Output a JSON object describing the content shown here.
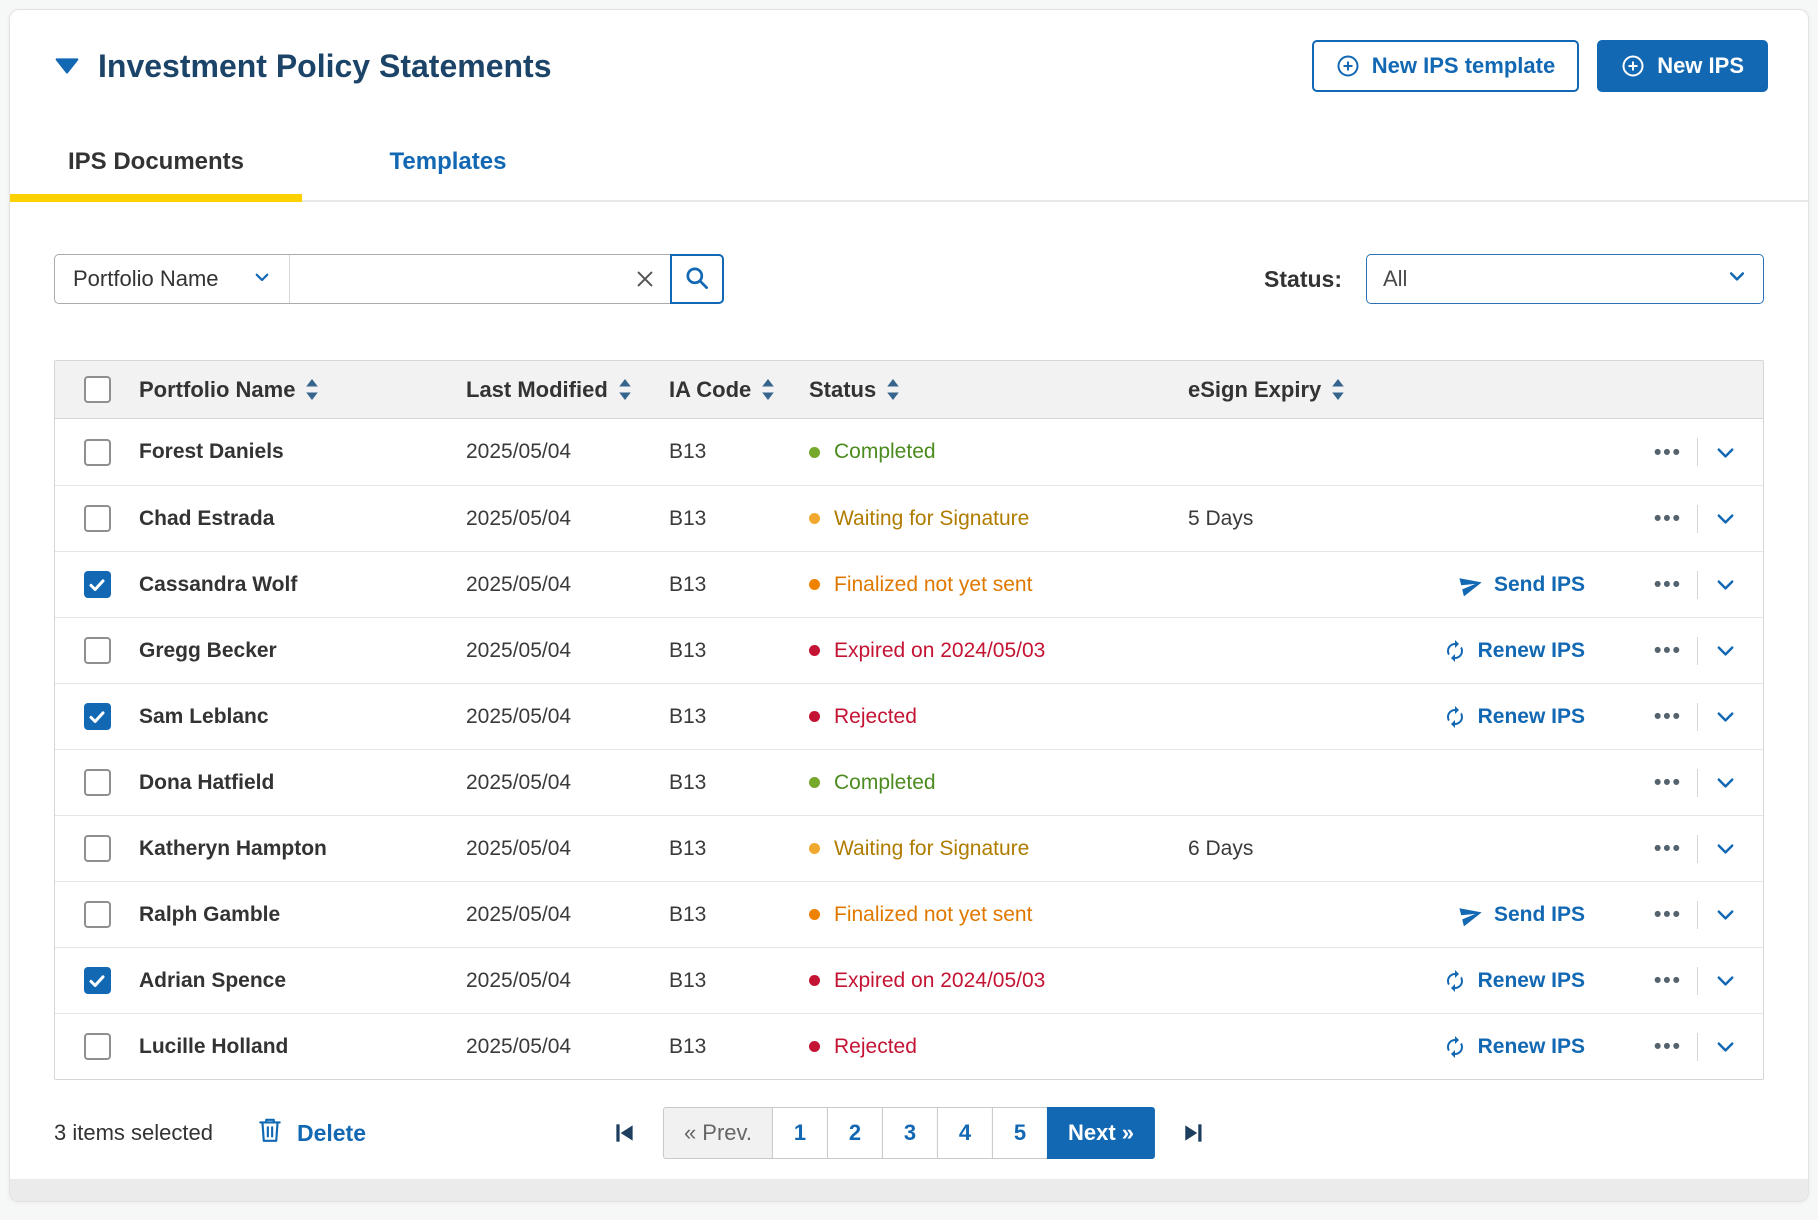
{
  "header": {
    "title": "Investment Policy Statements",
    "buttons": {
      "new_template": "New IPS template",
      "new_ips": "New IPS"
    }
  },
  "tabs": {
    "items": [
      {
        "label": "IPS Documents",
        "active": true
      },
      {
        "label": "Templates",
        "active": false
      }
    ]
  },
  "toolbar": {
    "search_field_selector": "Portfolio Name",
    "search_value": "",
    "status_label": "Status:",
    "status_value": "All"
  },
  "table": {
    "columns": [
      {
        "label": "Portfolio Name",
        "sortable": true
      },
      {
        "label": "Last Modified",
        "sortable": true
      },
      {
        "label": "IA Code",
        "sortable": true
      },
      {
        "label": "Status",
        "sortable": true
      },
      {
        "label": "eSign Expiry",
        "sortable": true
      }
    ],
    "status_colors": {
      "completed": {
        "dot": "#76a829",
        "text": "#4c8b1f"
      },
      "waiting": {
        "dot": "#f0a92e",
        "text": "#b07c00"
      },
      "finalized": {
        "dot": "#ef8200",
        "text": "#e07800"
      },
      "expired": {
        "dot": "#c41434",
        "text": "#c41434"
      },
      "rejected": {
        "dot": "#c41434",
        "text": "#c41434"
      }
    },
    "rows": [
      {
        "checked": false,
        "name": "Forest Daniels",
        "modified": "2025/05/04",
        "ia": "B13",
        "status": "Completed",
        "status_type": "completed",
        "expiry": "",
        "action": null
      },
      {
        "checked": false,
        "name": "Chad Estrada",
        "modified": "2025/05/04",
        "ia": "B13",
        "status": "Waiting for Signature",
        "status_type": "waiting",
        "expiry": "5 Days",
        "action": null
      },
      {
        "checked": true,
        "name": "Cassandra Wolf",
        "modified": "2025/05/04",
        "ia": "B13",
        "status": "Finalized not yet sent",
        "status_type": "finalized",
        "expiry": "",
        "action": {
          "type": "send",
          "label": "Send IPS"
        }
      },
      {
        "checked": false,
        "name": "Gregg Becker",
        "modified": "2025/05/04",
        "ia": "B13",
        "status": "Expired on 2024/05/03",
        "status_type": "expired",
        "expiry": "",
        "action": {
          "type": "renew",
          "label": "Renew IPS"
        }
      },
      {
        "checked": true,
        "name": "Sam Leblanc",
        "modified": "2025/05/04",
        "ia": "B13",
        "status": "Rejected",
        "status_type": "rejected",
        "expiry": "",
        "action": {
          "type": "renew",
          "label": "Renew IPS"
        }
      },
      {
        "checked": false,
        "name": "Dona Hatfield",
        "modified": "2025/05/04",
        "ia": "B13",
        "status": "Completed",
        "status_type": "completed",
        "expiry": "",
        "action": null
      },
      {
        "checked": false,
        "name": "Katheryn Hampton",
        "modified": "2025/05/04",
        "ia": "B13",
        "status": "Waiting for Signature",
        "status_type": "waiting",
        "expiry": "6 Days",
        "action": null
      },
      {
        "checked": false,
        "name": "Ralph Gamble",
        "modified": "2025/05/04",
        "ia": "B13",
        "status": "Finalized not yet sent",
        "status_type": "finalized",
        "expiry": "",
        "action": {
          "type": "send",
          "label": "Send IPS"
        }
      },
      {
        "checked": true,
        "name": "Adrian Spence",
        "modified": "2025/05/04",
        "ia": "B13",
        "status": "Expired on 2024/05/03",
        "status_type": "expired",
        "expiry": "",
        "action": {
          "type": "renew",
          "label": "Renew IPS"
        }
      },
      {
        "checked": false,
        "name": "Lucille Holland",
        "modified": "2025/05/04",
        "ia": "B13",
        "status": "Rejected",
        "status_type": "rejected",
        "expiry": "",
        "action": {
          "type": "renew",
          "label": "Renew IPS"
        }
      }
    ]
  },
  "footer": {
    "selected_text": "3 items selected",
    "delete_label": "Delete",
    "pagination": {
      "prev_label": "« Prev.",
      "pages": [
        "1",
        "2",
        "3",
        "4",
        "5"
      ],
      "next_label": "Next »"
    }
  },
  "colors": {
    "accent_blue": "#1268b3",
    "title_navy": "#1c4468",
    "tab_yellow": "#fdd100"
  }
}
